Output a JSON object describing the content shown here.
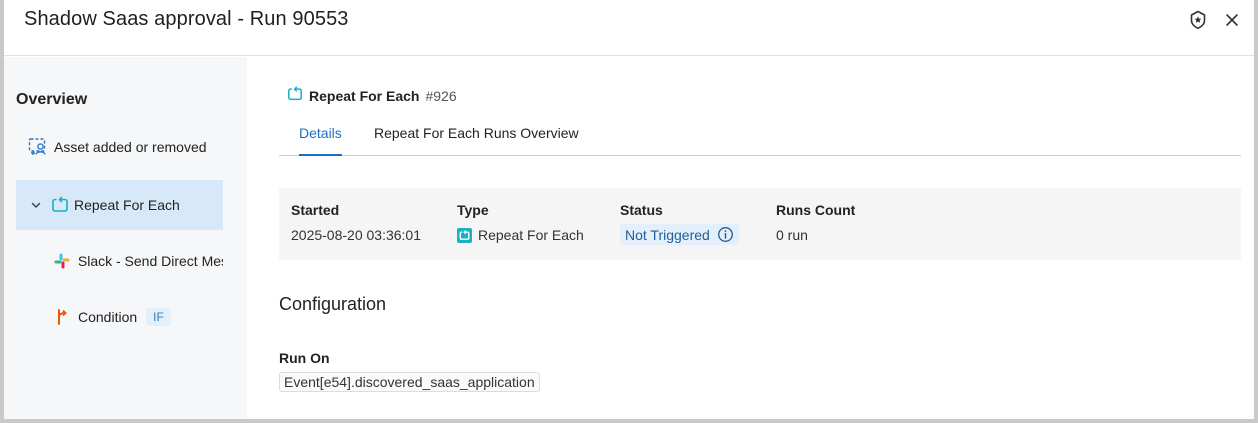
{
  "header": {
    "title": "Shadow Saas approval - Run 90553",
    "icons": [
      "shield-icon",
      "close-icon"
    ]
  },
  "sidebar": {
    "overview_label": "Overview",
    "items": [
      {
        "label": "Asset added or removed",
        "icon": "asset-user-icon"
      },
      {
        "label": "Repeat For Each",
        "icon": "repeat-icon",
        "active": true,
        "expanded": true
      },
      {
        "label": "Slack - Send Direct Mes",
        "icon": "slack-icon"
      },
      {
        "label": "Condition",
        "icon": "condition-icon",
        "badge": "IF"
      }
    ]
  },
  "node": {
    "name": "Repeat For Each",
    "number": "#926"
  },
  "tabs": [
    {
      "label": "Details",
      "active": true
    },
    {
      "label": "Repeat For Each Runs Overview",
      "active": false
    }
  ],
  "details": {
    "started_label": "Started",
    "started_value": "2025-08-20 03:36:01",
    "type_label": "Type",
    "type_value": "Repeat For Each",
    "status_label": "Status",
    "status_value": "Not Triggered",
    "runs_label": "Runs Count",
    "runs_value": "0 run"
  },
  "configuration": {
    "title": "Configuration",
    "run_on_label": "Run On",
    "run_on_value": "Event[e54].discovered_saas_application"
  },
  "colors": {
    "accent": "#1f6fc1",
    "repeat_teal": "#17b3c4",
    "active_bg": "#d7e8f8",
    "status_bg": "#e3effa"
  }
}
